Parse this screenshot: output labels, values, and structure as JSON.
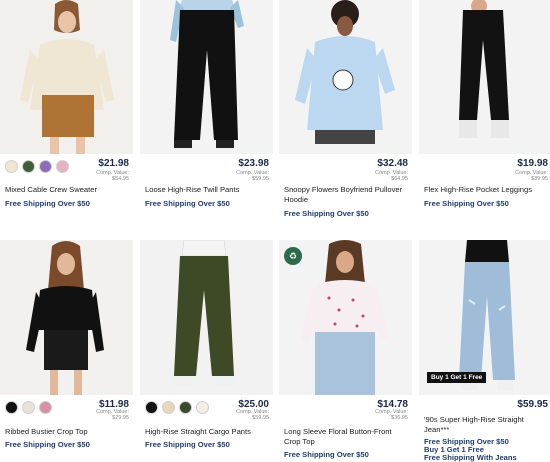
{
  "products": [
    {
      "name": "Mixed Cable Crew Sweater",
      "price": "$21.98",
      "comp_label": "Comp. Value:",
      "comp_value": "$54.95",
      "shipping": "Free Shipping Over $50",
      "swatch_colors": [
        "#efe6d3",
        "#3f5e3a",
        "#8d6bbd",
        "#e7b2c4"
      ]
    },
    {
      "name": "Loose High-Rise Twill Pants",
      "price": "$23.98",
      "comp_label": "Comp. Value:",
      "comp_value": "$59.95",
      "shipping": "Free Shipping Over $50",
      "swatch_colors": []
    },
    {
      "name": "Snoopy Flowers Boyfriend Pullover Hoodie",
      "price": "$32.48",
      "comp_label": "Comp. Value:",
      "comp_value": "$64.95",
      "shipping": "Free Shipping Over $50",
      "swatch_colors": []
    },
    {
      "name": "Flex High-Rise Pocket Leggings",
      "price": "$19.98",
      "comp_label": "Comp. Value:",
      "comp_value": "$39.95",
      "shipping": "Free Shipping Over $50",
      "swatch_colors": []
    },
    {
      "name": "Ribbed Bustier Crop Top",
      "price": "$11.98",
      "comp_label": "Comp. Value:",
      "comp_value": "$29.95",
      "shipping": "Free Shipping Over $50",
      "swatch_colors": [
        "#111111",
        "#e6e3df",
        "#d98fa5"
      ]
    },
    {
      "name": "High-Rise Straight Cargo Pants",
      "price": "$25.00",
      "comp_label": "Comp. Value:",
      "comp_value": "$59.95",
      "shipping": "Free Shipping Over $50",
      "swatch_colors": [
        "#111111",
        "#e9d6b8",
        "#3a4a2c",
        "#f2efe6"
      ]
    },
    {
      "name": "Long Sleeve Floral Button-Front Crop Top",
      "price": "$14.78",
      "comp_label": "Comp. Value:",
      "comp_value": "$36.95",
      "shipping": "Free Shipping Over $50",
      "swatch_colors": []
    },
    {
      "name": "'90s Super High-Rise Straight Jean***",
      "price": "$59.95",
      "comp_label": "",
      "comp_value": "",
      "shipping": "Free Shipping Over $50",
      "promo_line1": "Buy 1 Get 1 Free",
      "promo_line2": "Free Shipping With Jeans",
      "badge": "Buy 1 Get 1 Free",
      "swatch_colors": []
    }
  ],
  "colors": {
    "price": "#1b2a4a",
    "shipping": "#1f3c6e",
    "image_bg": "#f1f1f1"
  }
}
